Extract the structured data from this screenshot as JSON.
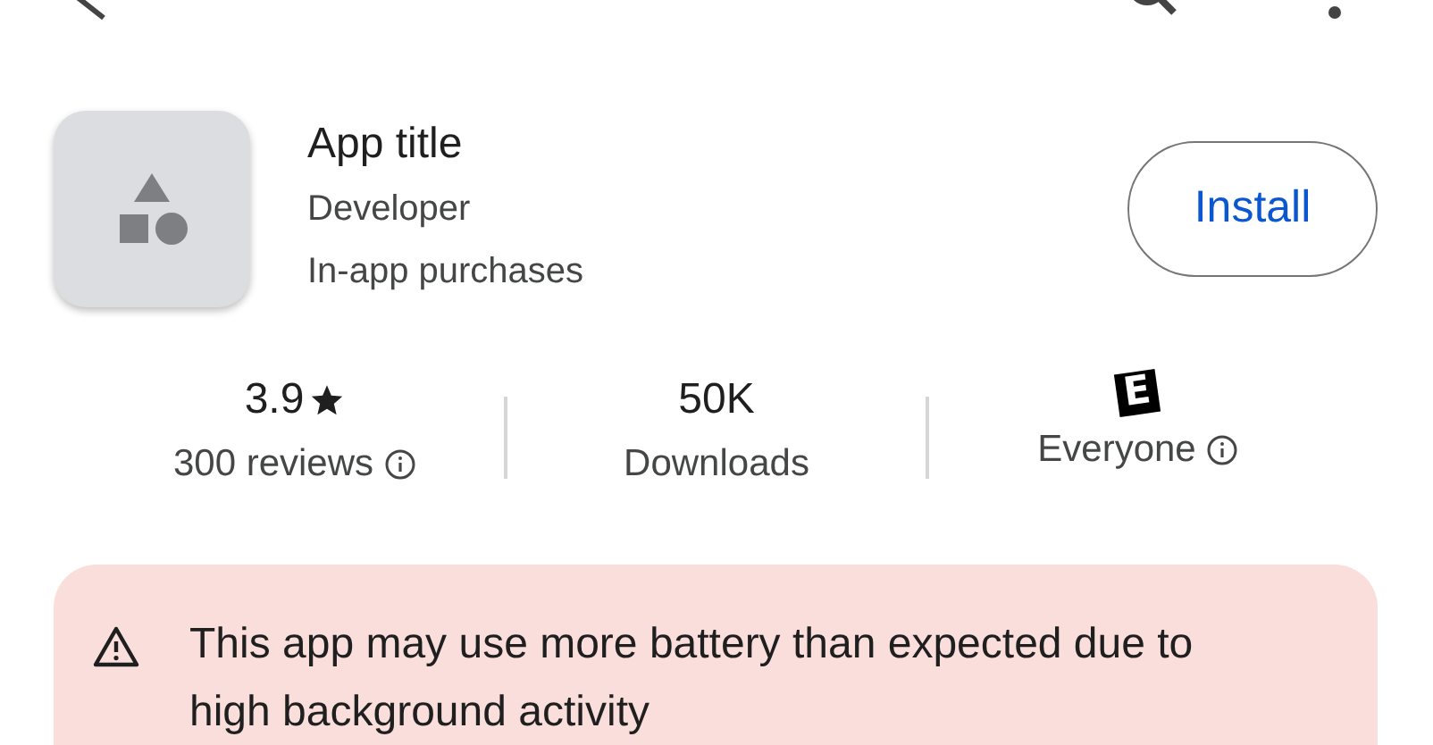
{
  "app": {
    "title": "App title",
    "developer": "Developer",
    "note": "In-app purchases"
  },
  "install_button": "Install",
  "stats": [
    {
      "kind": "rating",
      "value": "3.9",
      "label": "300 reviews",
      "info": true
    },
    {
      "kind": "plain",
      "value": "50K",
      "label": "Downloads",
      "info": false
    },
    {
      "kind": "badge",
      "value": "E",
      "label": "Everyone",
      "info": true
    }
  ],
  "warning": "This app may use more battery than expected due to high background activity"
}
